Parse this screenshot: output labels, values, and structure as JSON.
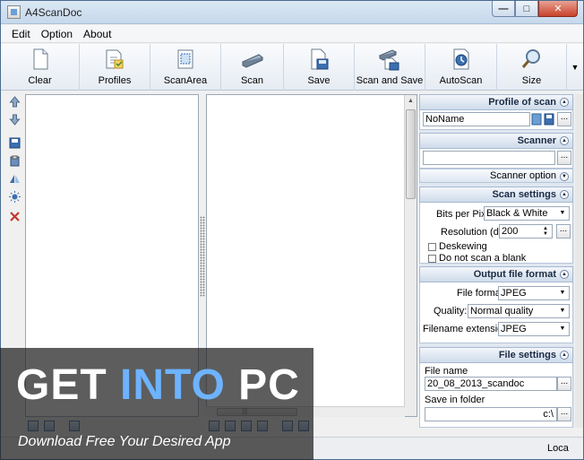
{
  "window": {
    "title": "A4ScanDoc"
  },
  "menu": {
    "items": [
      "Edit",
      "Option",
      "About"
    ]
  },
  "toolbar": {
    "buttons": [
      {
        "label": "Clear",
        "icon": "document-icon"
      },
      {
        "label": "Profiles",
        "icon": "profiles-icon"
      },
      {
        "label": "ScanArea",
        "icon": "scan-area-icon"
      },
      {
        "label": "Scan",
        "icon": "scanner-icon"
      },
      {
        "label": "Save",
        "icon": "save-icon"
      },
      {
        "label": "Scan and Save",
        "icon": "scan-and-save-icon"
      },
      {
        "label": "AutoScan",
        "icon": "autoscan-icon"
      },
      {
        "label": "Size",
        "icon": "magnifier-icon"
      }
    ]
  },
  "right_panel": {
    "profile": {
      "title": "Profile of scan",
      "value": "NoName",
      "more": "..."
    },
    "scanner": {
      "title": "Scanner",
      "value": "",
      "more": "...",
      "option_label": "Scanner option"
    },
    "scan_settings": {
      "title": "Scan settings",
      "bits_label": "Bits per Pixel",
      "bits_value": "Black & White",
      "resolution_label": "Resolution (dpi)",
      "resolution_value": "200",
      "more": "...",
      "deskew_label": "Deskewing",
      "blank_label": "Do not scan a blank"
    },
    "output": {
      "title": "Output file format",
      "format_label": "File format",
      "format_value": "JPEG",
      "quality_label": "Quality:",
      "quality_value": "Normal quality",
      "ext_label": "Filename extension:",
      "ext_value": "JPEG"
    },
    "file_settings": {
      "title": "File settings",
      "name_label": "File name",
      "name_value": "20_08_2013_scandoc",
      "folder_label": "Save in  folder",
      "folder_value": "c:\\",
      "more": "..."
    }
  },
  "status": {
    "text": "Loca"
  },
  "watermark": {
    "title_a": "GET ",
    "title_b": "INTO",
    "title_c": " PC",
    "subtitle": "Download Free Your Desired App"
  },
  "colors": {
    "accent": "#6db3ff",
    "header_blue": "#cedbeb"
  }
}
